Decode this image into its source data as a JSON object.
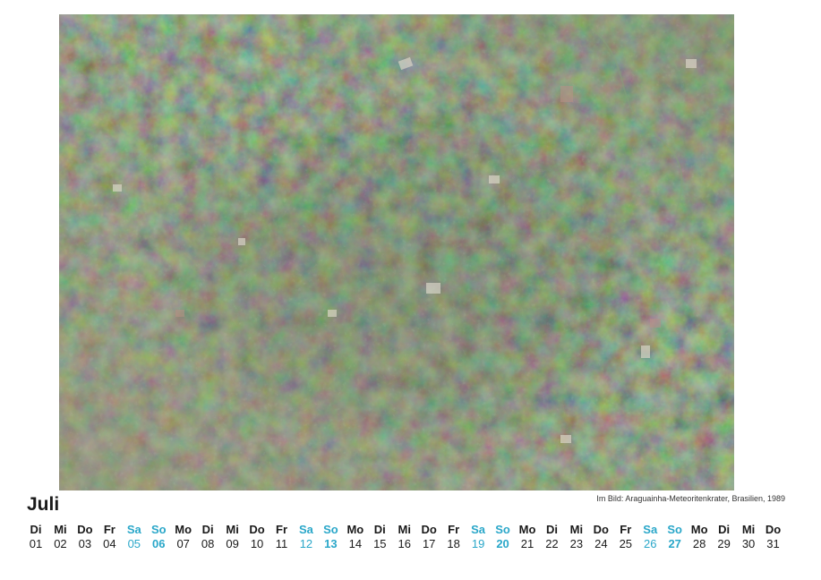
{
  "caption": "Im Bild: Araguainha-Meteoritenkrater, Brasilien, 1989",
  "month": "Juli",
  "colors": {
    "weekend": "#2aa7c9",
    "text": "#1a1a1a"
  },
  "days": [
    {
      "wd": "Di",
      "num": "01",
      "weekend": false
    },
    {
      "wd": "Mi",
      "num": "02",
      "weekend": false
    },
    {
      "wd": "Do",
      "num": "03",
      "weekend": false
    },
    {
      "wd": "Fr",
      "num": "04",
      "weekend": false
    },
    {
      "wd": "Sa",
      "num": "05",
      "weekend": true
    },
    {
      "wd": "So",
      "num": "06",
      "weekend": true
    },
    {
      "wd": "Mo",
      "num": "07",
      "weekend": false
    },
    {
      "wd": "Di",
      "num": "08",
      "weekend": false
    },
    {
      "wd": "Mi",
      "num": "09",
      "weekend": false
    },
    {
      "wd": "Do",
      "num": "10",
      "weekend": false
    },
    {
      "wd": "Fr",
      "num": "11",
      "weekend": false
    },
    {
      "wd": "Sa",
      "num": "12",
      "weekend": true
    },
    {
      "wd": "So",
      "num": "13",
      "weekend": true
    },
    {
      "wd": "Mo",
      "num": "14",
      "weekend": false
    },
    {
      "wd": "Di",
      "num": "15",
      "weekend": false
    },
    {
      "wd": "Mi",
      "num": "16",
      "weekend": false
    },
    {
      "wd": "Do",
      "num": "17",
      "weekend": false
    },
    {
      "wd": "Fr",
      "num": "18",
      "weekend": false
    },
    {
      "wd": "Sa",
      "num": "19",
      "weekend": true
    },
    {
      "wd": "So",
      "num": "20",
      "weekend": true
    },
    {
      "wd": "Mo",
      "num": "21",
      "weekend": false
    },
    {
      "wd": "Di",
      "num": "22",
      "weekend": false
    },
    {
      "wd": "Mi",
      "num": "23",
      "weekend": false
    },
    {
      "wd": "Do",
      "num": "24",
      "weekend": false
    },
    {
      "wd": "Fr",
      "num": "25",
      "weekend": false
    },
    {
      "wd": "Sa",
      "num": "26",
      "weekend": true
    },
    {
      "wd": "So",
      "num": "27",
      "weekend": true
    },
    {
      "wd": "Mo",
      "num": "28",
      "weekend": false
    },
    {
      "wd": "Di",
      "num": "29",
      "weekend": false
    },
    {
      "wd": "Mi",
      "num": "30",
      "weekend": false
    },
    {
      "wd": "Do",
      "num": "31",
      "weekend": false
    }
  ]
}
